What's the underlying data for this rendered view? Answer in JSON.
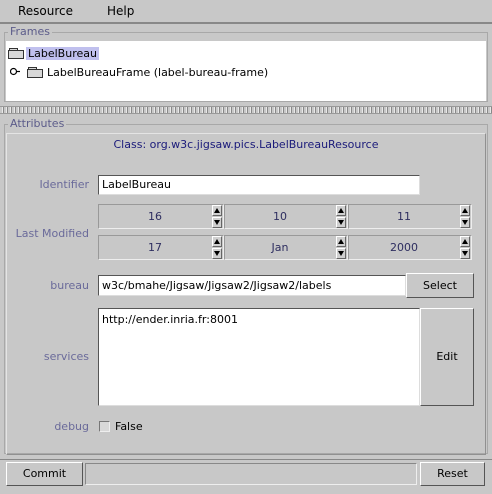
{
  "menubar": {
    "items": [
      {
        "label": "Resource"
      },
      {
        "label": "Help"
      }
    ]
  },
  "frames": {
    "title": "Frames",
    "tree": {
      "root_label": "LabelBureau",
      "child_label": "LabelBureauFrame (label-bureau-frame)"
    }
  },
  "attributes": {
    "title": "Attributes",
    "class_label": "Class: org.w3c.jigsaw.pics.LabelBureauResource",
    "identifier": {
      "label": "Identifier",
      "value": "LabelBureau"
    },
    "last_modified": {
      "label": "Last Modified",
      "time": [
        "16",
        "10",
        "11"
      ],
      "date": [
        "17",
        "Jan",
        "2000"
      ]
    },
    "bureau": {
      "label": "bureau",
      "value": "w3c/bmahe/Jigsaw/Jigsaw2/Jigsaw2/labels",
      "button": "Select"
    },
    "services": {
      "label": "services",
      "value": "http://ender.inria.fr:8001",
      "button": "Edit"
    },
    "debug": {
      "label": "debug",
      "value": "False",
      "checked": false
    }
  },
  "bottom": {
    "commit": "Commit",
    "reset": "Reset",
    "status": ""
  }
}
